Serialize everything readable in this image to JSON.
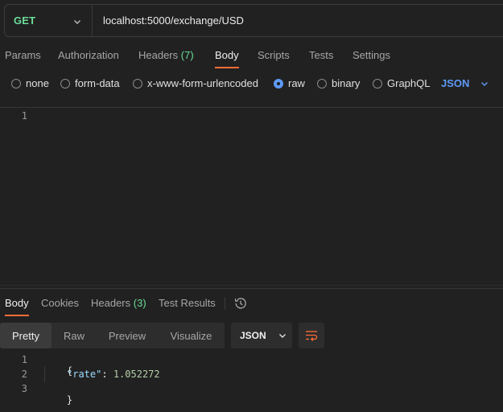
{
  "request": {
    "method": "GET",
    "url": "localhost:5000/exchange/USD"
  },
  "request_tabs": [
    {
      "label": "Params"
    },
    {
      "label": "Authorization"
    },
    {
      "label": "Headers",
      "count": "(7)"
    },
    {
      "label": "Body"
    },
    {
      "label": "Scripts"
    },
    {
      "label": "Tests"
    },
    {
      "label": "Settings"
    }
  ],
  "body_types": [
    {
      "label": "none"
    },
    {
      "label": "form-data"
    },
    {
      "label": "x-www-form-urlencoded"
    },
    {
      "label": "raw"
    },
    {
      "label": "binary"
    },
    {
      "label": "GraphQL"
    }
  ],
  "body_language": "JSON",
  "request_editor": {
    "line_numbers": [
      "1"
    ]
  },
  "response_tabs": [
    {
      "label": "Body"
    },
    {
      "label": "Cookies"
    },
    {
      "label": "Headers",
      "count": "(3)"
    },
    {
      "label": "Test Results"
    }
  ],
  "response_views": [
    {
      "label": "Pretty"
    },
    {
      "label": "Raw"
    },
    {
      "label": "Preview"
    },
    {
      "label": "Visualize"
    }
  ],
  "response_language": "JSON",
  "response_body": {
    "line_numbers": [
      "1",
      "2",
      "3"
    ],
    "open_brace": "{",
    "key": "\"rate\"",
    "colon": ":",
    "value": "1.052272",
    "close_brace": "}"
  },
  "colors": {
    "background": "#212121",
    "method_green": "#6bdd9a",
    "accent_orange": "#ff6c37",
    "accent_blue": "#5e9af7"
  },
  "icons": [
    "chevron-down-icon",
    "history-icon",
    "wrap-lines-icon"
  ]
}
